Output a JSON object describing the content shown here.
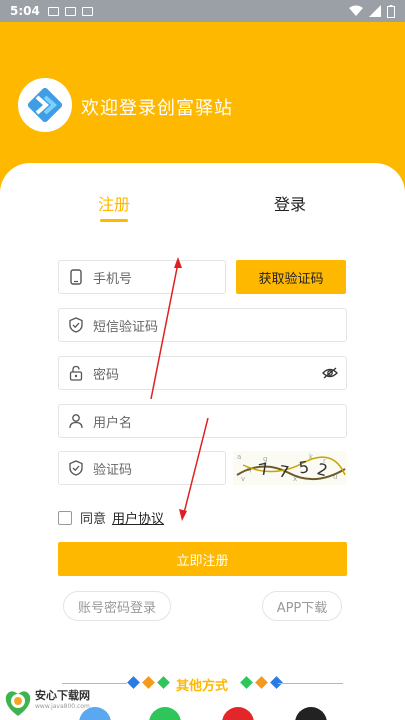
{
  "status_bar": {
    "time": "5:04"
  },
  "header": {
    "welcome": "欢迎登录创富驿站"
  },
  "tabs": {
    "register": "注册",
    "login": "登录"
  },
  "form": {
    "phone_placeholder": "手机号",
    "sms_button": "获取验证码",
    "sms_code_placeholder": "短信验证码",
    "password_placeholder": "密码",
    "username_placeholder": "用户名",
    "captcha_placeholder": "验证码",
    "agree_text": "同意",
    "agreement_link": "用户协议",
    "submit": "立即注册"
  },
  "alt_links": {
    "password_login": "账号密码登录",
    "app_download": "APP下载"
  },
  "other_methods": {
    "title": "其他方式"
  },
  "watermark": {
    "brand": "安心下载网",
    "url": "www.java800.com"
  },
  "colors": {
    "accent": "#ffb800",
    "annotation": "#e02020"
  }
}
